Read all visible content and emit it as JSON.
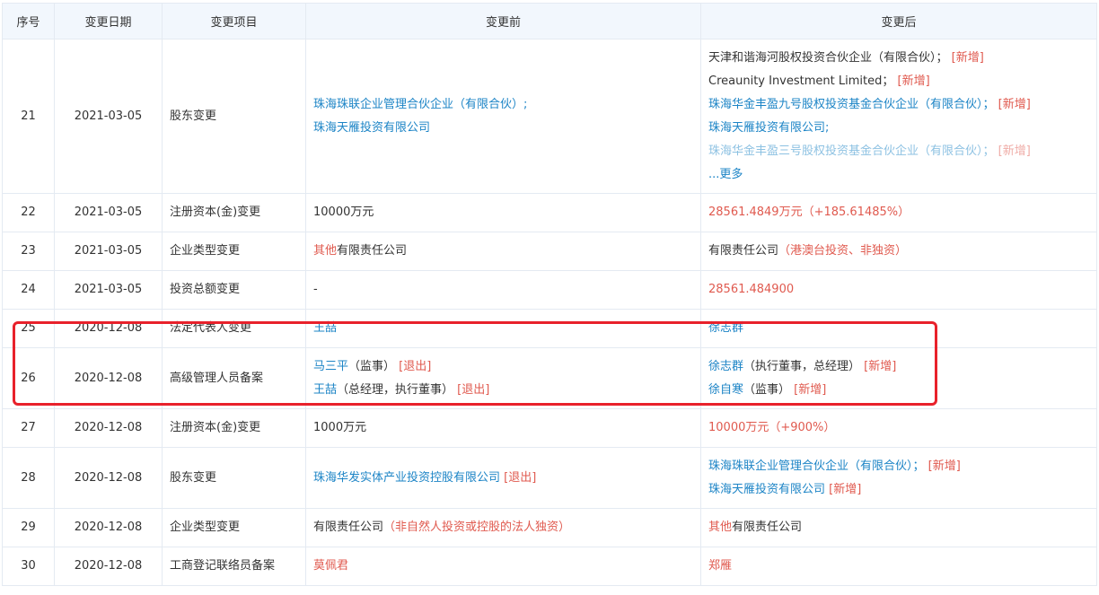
{
  "headers": [
    "序号",
    "变更日期",
    "变更项目",
    "变更前",
    "变更后"
  ],
  "rows": [
    {
      "no": "21",
      "date": "2021-03-05",
      "item": "股东变更",
      "before": [
        {
          "parts": [
            {
              "t": "珠海珠联企业管理合伙企业（有限合伙）;",
              "c": "link"
            }
          ]
        },
        {
          "parts": [
            {
              "t": "珠海天雁投资有限公司",
              "c": "link"
            }
          ]
        }
      ],
      "after": [
        {
          "parts": [
            {
              "t": "天津和谐海河股权投资合伙企业（有限合伙）；",
              "c": ""
            },
            {
              "t": " [新增]",
              "c": "tag"
            }
          ]
        },
        {
          "parts": [
            {
              "t": "Creaunity Investment Limited；",
              "c": ""
            },
            {
              "t": " [新增]",
              "c": "tag"
            }
          ]
        },
        {
          "parts": [
            {
              "t": "珠海华金丰盈九号股权投资基金合伙企业（有限合伙）；",
              "c": "link"
            },
            {
              "t": " [新增]",
              "c": "tag"
            }
          ]
        },
        {
          "parts": [
            {
              "t": "珠海天雁投资有限公司;",
              "c": "link"
            }
          ]
        },
        {
          "parts": [
            {
              "t": "珠海华金丰盈三号股权投资基金合伙企业（有限合伙）；",
              "c": "link"
            },
            {
              "t": " [新增]",
              "c": "tag"
            }
          ],
          "fade": true
        }
      ],
      "more": "...更多"
    },
    {
      "no": "22",
      "date": "2021-03-05",
      "item": "注册资本(金)变更",
      "before": [
        {
          "parts": [
            {
              "t": "10000万元",
              "c": ""
            }
          ]
        }
      ],
      "after": [
        {
          "parts": [
            {
              "t": "28561.4849万元（+185.61485%）",
              "c": "red"
            }
          ]
        }
      ]
    },
    {
      "no": "23",
      "date": "2021-03-05",
      "item": "企业类型变更",
      "before": [
        {
          "parts": [
            {
              "t": "其他",
              "c": "red"
            },
            {
              "t": "有限责任公司",
              "c": ""
            }
          ]
        }
      ],
      "after": [
        {
          "parts": [
            {
              "t": "有限责任公司",
              "c": ""
            },
            {
              "t": "（港澳台投资、非独资）",
              "c": "red"
            }
          ]
        }
      ]
    },
    {
      "no": "24",
      "date": "2021-03-05",
      "item": "投资总额变更",
      "before": [
        {
          "parts": [
            {
              "t": "-",
              "c": ""
            }
          ]
        }
      ],
      "after": [
        {
          "parts": [
            {
              "t": "28561.484900",
              "c": "red"
            }
          ]
        }
      ]
    },
    {
      "no": "25",
      "date": "2020-12-08",
      "item": "法定代表人变更",
      "before": [
        {
          "parts": [
            {
              "t": "王喆",
              "c": "link"
            }
          ]
        }
      ],
      "after": [
        {
          "parts": [
            {
              "t": "徐志群",
              "c": "link"
            }
          ]
        }
      ]
    },
    {
      "no": "26",
      "date": "2020-12-08",
      "item": "高级管理人员备案",
      "before": [
        {
          "parts": [
            {
              "t": "马三平",
              "c": "link"
            },
            {
              "t": "（监事）",
              "c": ""
            },
            {
              "t": " [退出]",
              "c": "tag"
            }
          ]
        },
        {
          "parts": [
            {
              "t": "王喆",
              "c": "link"
            },
            {
              "t": "（总经理，执行董事）",
              "c": ""
            },
            {
              "t": " [退出]",
              "c": "tag"
            }
          ]
        }
      ],
      "after": [
        {
          "parts": [
            {
              "t": "徐志群",
              "c": "link"
            },
            {
              "t": "（执行董事，总经理）",
              "c": ""
            },
            {
              "t": " [新增]",
              "c": "tag"
            }
          ]
        },
        {
          "parts": [
            {
              "t": "徐自寒",
              "c": "link"
            },
            {
              "t": "（监事）",
              "c": ""
            },
            {
              "t": " [新增]",
              "c": "tag"
            }
          ]
        }
      ]
    },
    {
      "no": "27",
      "date": "2020-12-08",
      "item": "注册资本(金)变更",
      "before": [
        {
          "parts": [
            {
              "t": "1000万元",
              "c": ""
            }
          ]
        }
      ],
      "after": [
        {
          "parts": [
            {
              "t": "10000万元（+900%）",
              "c": "red"
            }
          ]
        }
      ]
    },
    {
      "no": "28",
      "date": "2020-12-08",
      "item": "股东变更",
      "before": [
        {
          "parts": [
            {
              "t": "珠海华发实体产业投资控股有限公司",
              "c": "link"
            },
            {
              "t": " [退出]",
              "c": "tag"
            }
          ]
        }
      ],
      "after": [
        {
          "parts": [
            {
              "t": "珠海珠联企业管理合伙企业（有限合伙）；",
              "c": "link"
            },
            {
              "t": " [新增]",
              "c": "tag"
            }
          ]
        },
        {
          "parts": [
            {
              "t": "珠海天雁投资有限公司",
              "c": "link"
            },
            {
              "t": " [新增]",
              "c": "tag"
            }
          ]
        }
      ]
    },
    {
      "no": "29",
      "date": "2020-12-08",
      "item": "企业类型变更",
      "before": [
        {
          "parts": [
            {
              "t": "有限责任公司",
              "c": ""
            },
            {
              "t": "（非自然人投资或控股的法人独资）",
              "c": "red"
            }
          ]
        }
      ],
      "after": [
        {
          "parts": [
            {
              "t": "其他",
              "c": "red"
            },
            {
              "t": "有限责任公司",
              "c": ""
            }
          ]
        }
      ]
    },
    {
      "no": "30",
      "date": "2020-12-08",
      "item": "工商登记联络员备案",
      "before": [
        {
          "parts": [
            {
              "t": "莫佩君",
              "c": "red"
            }
          ]
        }
      ],
      "after": [
        {
          "parts": [
            {
              "t": "郑雁",
              "c": "red"
            }
          ]
        }
      ]
    }
  ],
  "highlight_color": "#e8212b",
  "colors": {
    "link": "#1c84c6",
    "red": "#e05a4f",
    "header_bg": "#f2f7fd"
  }
}
